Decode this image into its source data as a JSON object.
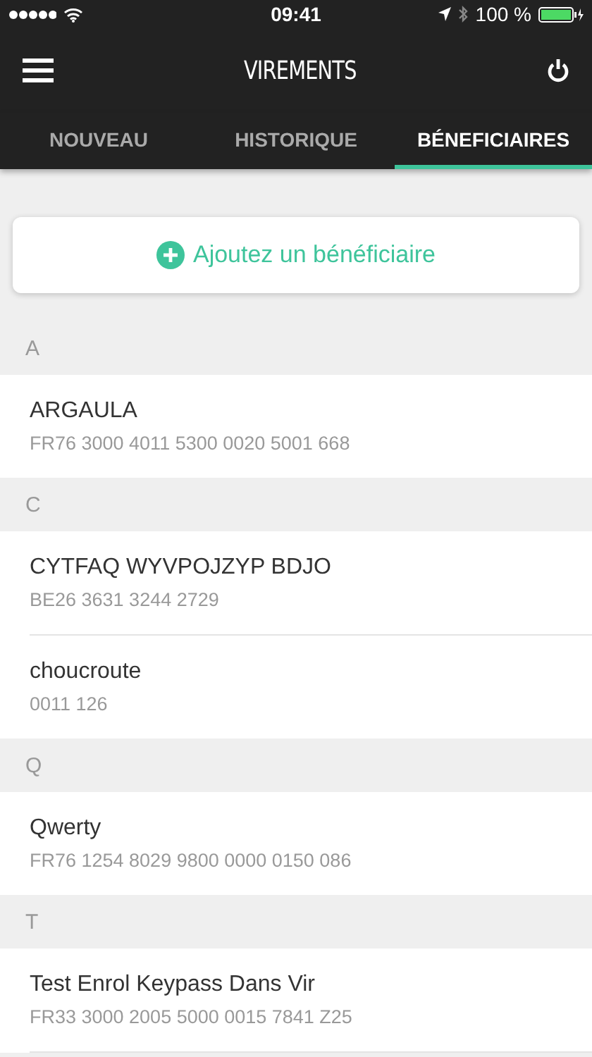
{
  "status_bar": {
    "time": "09:41",
    "battery": "100 %"
  },
  "header": {
    "title": "VIREMENTS"
  },
  "tabs": [
    {
      "label": "NOUVEAU",
      "selected": false
    },
    {
      "label": "HISTORIQUE",
      "selected": false
    },
    {
      "label": "BÉNEFICIAIRES",
      "selected": true
    }
  ],
  "add_button": {
    "label": "Ajoutez un bénéficiaire"
  },
  "sections": [
    {
      "letter": "A",
      "items": [
        {
          "name": "ARGAULA",
          "iban": "FR76 3000 4011 5300 0020 5001 668"
        }
      ]
    },
    {
      "letter": "C",
      "items": [
        {
          "name": "CYTFAQ WYVPOJZYP BDJO",
          "iban": "BE26 3631 3244 2729"
        },
        {
          "name": "choucroute",
          "iban": "0011 126"
        }
      ]
    },
    {
      "letter": "Q",
      "items": [
        {
          "name": "Qwerty",
          "iban": "FR76 1254 8029 9800 0000 0150 086"
        }
      ]
    },
    {
      "letter": "T",
      "items": [
        {
          "name": "Test Enrol Keypass Dans Vir",
          "iban": "FR33 3000 2005 5000 0015 7841 Z25"
        }
      ]
    }
  ]
}
